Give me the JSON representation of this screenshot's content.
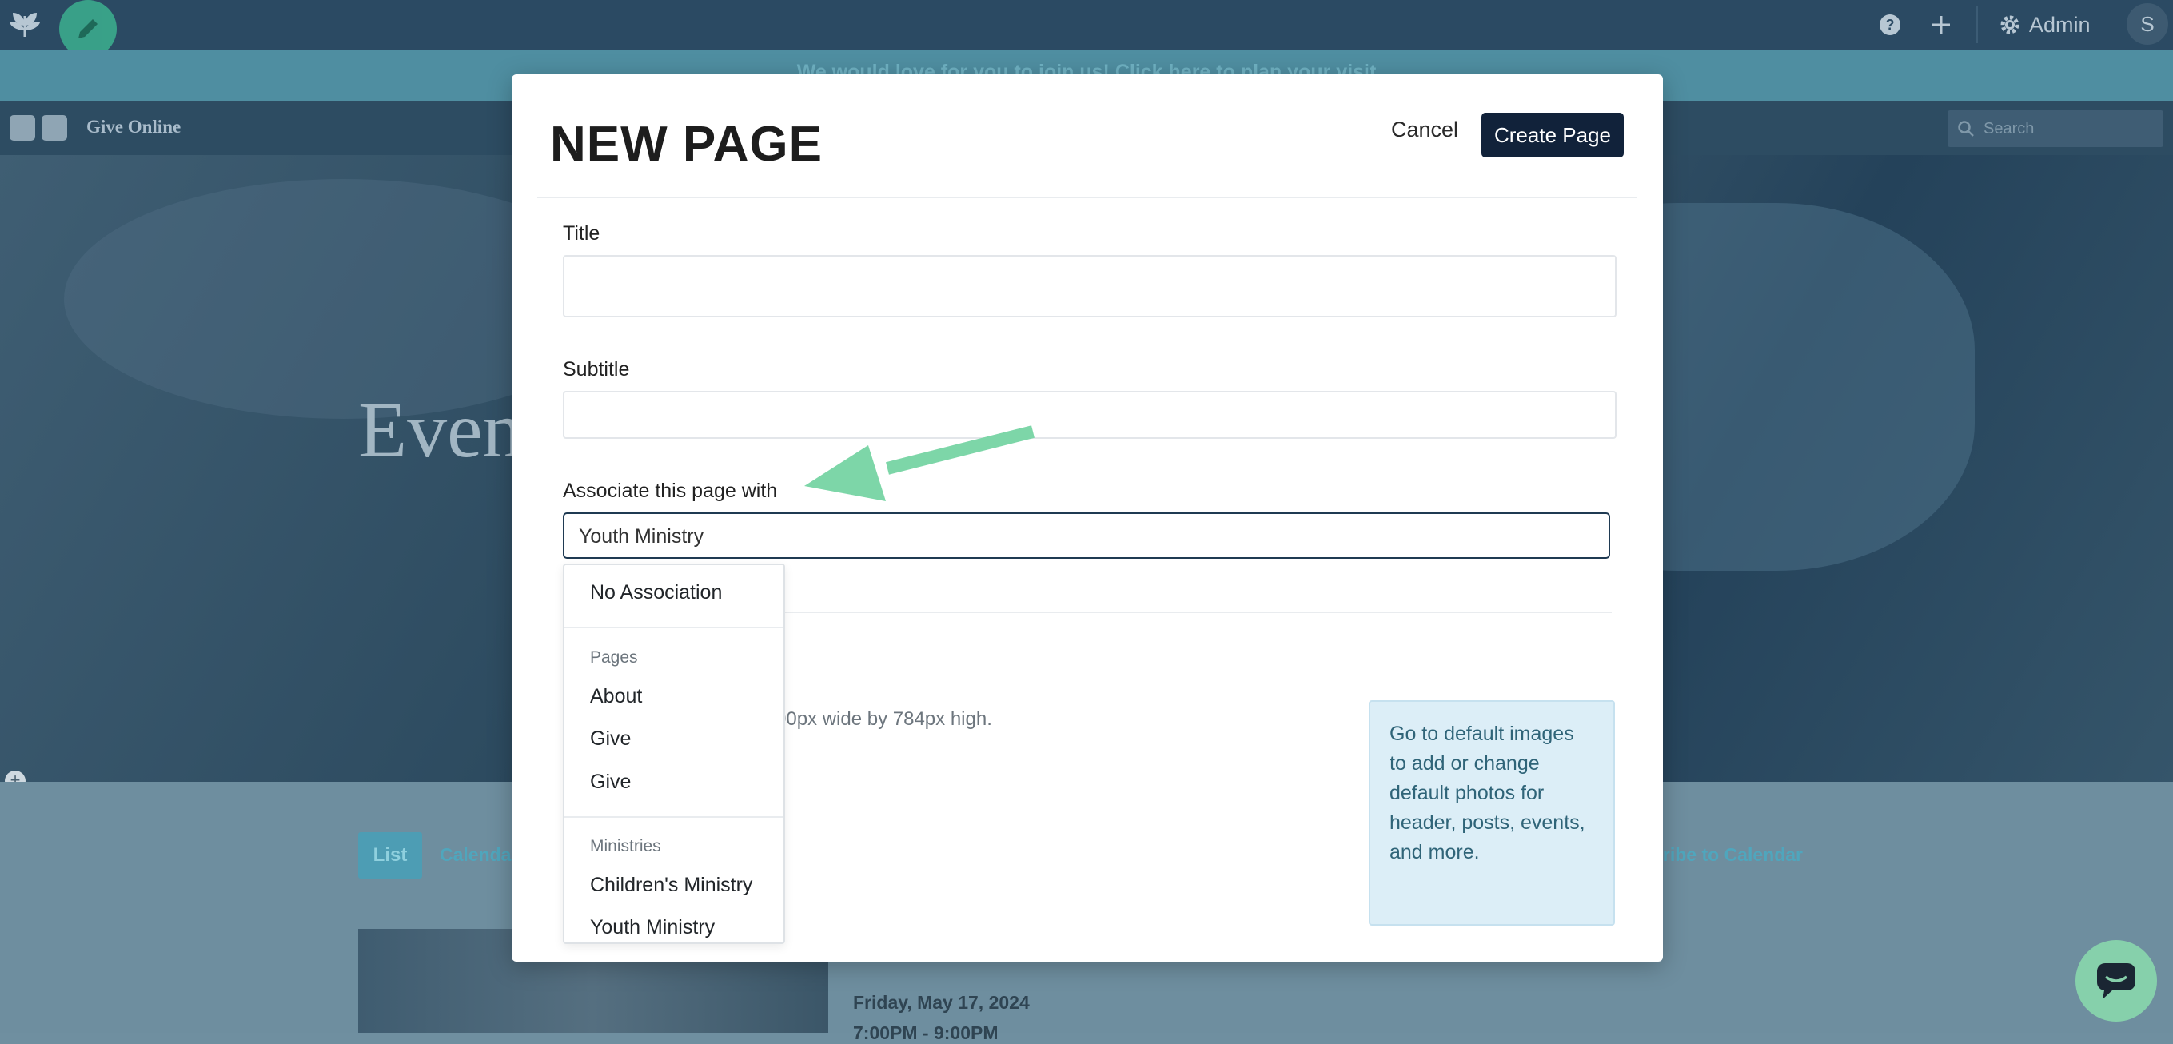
{
  "admin_bar": {
    "admin_label": "Admin",
    "avatar_initial": "S"
  },
  "announcement": {
    "text": "We would love for you to join us! Click here to plan your visit"
  },
  "site_nav": {
    "give_online": "Give Online",
    "search_placeholder": "Search"
  },
  "hero": {
    "title_visible": "Even"
  },
  "events_bar": {
    "list_button": "List",
    "calendar_link": "Calendar",
    "subscribe_link": "Subscribe to Calendar"
  },
  "event": {
    "date": "Friday, May 17, 2024",
    "time": "7:00PM - 9:00PM"
  },
  "modal": {
    "title": "NEW PAGE",
    "cancel_label": "Cancel",
    "create_label": "Create Page",
    "title_field": {
      "label": "Title",
      "value": ""
    },
    "subtitle_field": {
      "label": "Subtitle",
      "value": ""
    },
    "associate_field": {
      "label": "Associate this page with",
      "value": "Youth Ministry"
    },
    "image_hint": "00px wide by 784px high.",
    "info_box": "Go to default images to add or change default photos for header, posts, events, and more."
  },
  "dropdown": {
    "no_association": "No Association",
    "groups": [
      {
        "header": "Pages",
        "items": [
          "About",
          "Give",
          "Give"
        ]
      },
      {
        "header": "Ministries",
        "items": [
          "Children's Ministry",
          "Youth Ministry"
        ]
      }
    ]
  },
  "colors": {
    "admin_bar": "#2b4a63",
    "primary_button": "#11223a",
    "arrow": "#7dd6a8",
    "info_box_bg": "#dceef7"
  }
}
